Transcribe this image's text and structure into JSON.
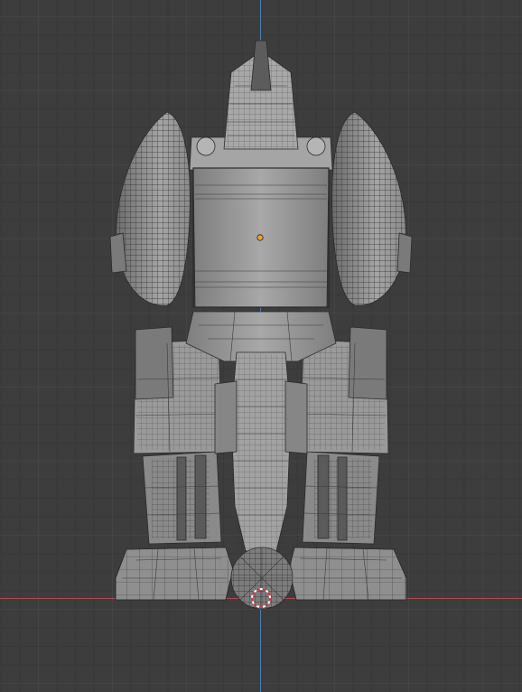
{
  "viewport": {
    "grid_color": "#464646",
    "background_color": "#3d3d3d"
  },
  "axes": {
    "z_axis_color": "#4a7fb5",
    "x_axis_color": "#b04a55"
  },
  "model": {
    "base_color": "#9a9a9a",
    "light_color": "#c4c4c4",
    "dark_color": "#6e6e6e",
    "origin_color": "#f0a030"
  },
  "icons": {
    "origin": "origin-dot-icon",
    "cursor": "3d-cursor-icon"
  }
}
